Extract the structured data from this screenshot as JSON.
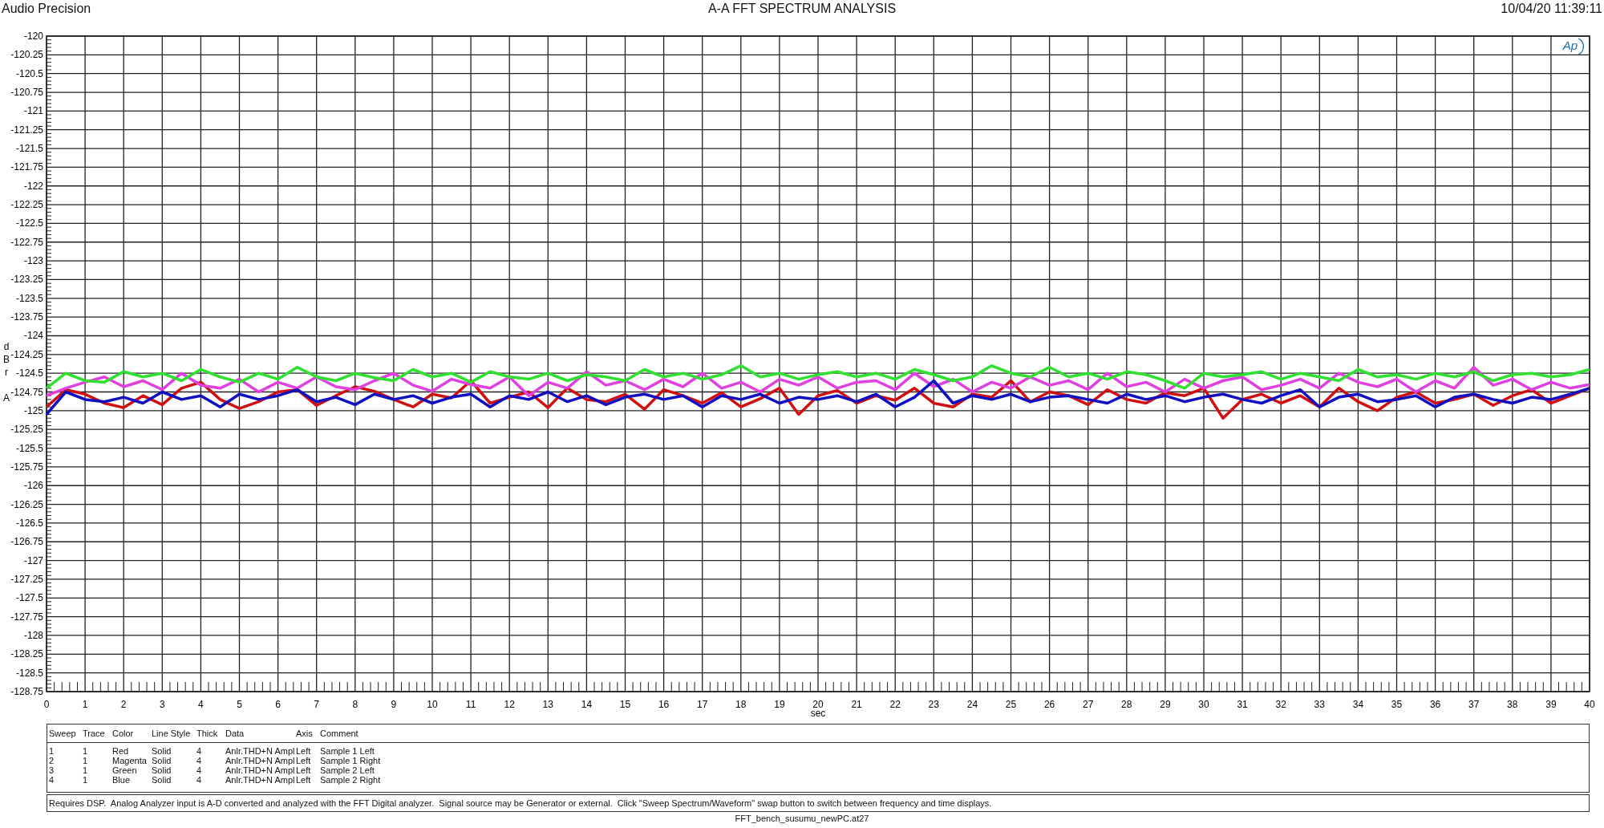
{
  "header": {
    "brand": "Audio Precision",
    "title": "A-A FFT SPECTRUM ANALYSIS",
    "timestamp": "10/04/20 11:39:11"
  },
  "plot": {
    "logo": "Ap",
    "chart_data": {
      "type": "line",
      "grid": true,
      "xlabel": "sec",
      "ylabel": "dBr A",
      "xlim": [
        0,
        40
      ],
      "ylim": [
        -128.75,
        -120
      ],
      "xticks": [
        0,
        1,
        2,
        3,
        4,
        5,
        6,
        7,
        8,
        9,
        10,
        11,
        12,
        13,
        14,
        15,
        16,
        17,
        18,
        19,
        20,
        21,
        22,
        23,
        24,
        25,
        26,
        27,
        28,
        29,
        30,
        31,
        32,
        33,
        34,
        35,
        36,
        37,
        38,
        39,
        40
      ],
      "yticks": [
        -120,
        -120.25,
        -120.5,
        -120.75,
        -121,
        -121.25,
        -121.5,
        -121.75,
        -122,
        -122.25,
        -122.5,
        -122.75,
        -123,
        -123.25,
        -123.5,
        -123.75,
        -124,
        -124.25,
        -124.5,
        -124.75,
        -125,
        -125.25,
        -125.5,
        -125.75,
        -126,
        -126.25,
        -126.5,
        -126.75,
        -127,
        -127.25,
        -127.5,
        -127.75,
        -128,
        -128.25,
        -128.5,
        -128.75
      ],
      "x": [
        0,
        0.5,
        1,
        1.5,
        2,
        2.5,
        3,
        3.5,
        4,
        4.5,
        5,
        5.5,
        6,
        6.5,
        7,
        7.5,
        8,
        8.5,
        9,
        9.5,
        10,
        10.5,
        11,
        11.5,
        12,
        12.5,
        13,
        13.5,
        14,
        14.5,
        15,
        15.5,
        16,
        16.5,
        17,
        17.5,
        18,
        18.5,
        19,
        19.5,
        20,
        20.5,
        21,
        21.5,
        22,
        22.5,
        23,
        23.5,
        24,
        24.5,
        25,
        25.5,
        26,
        26.5,
        27,
        27.5,
        28,
        28.5,
        29,
        29.5,
        30,
        30.5,
        31,
        31.5,
        32,
        32.5,
        33,
        33.5,
        34,
        34.5,
        35,
        35.5,
        36,
        36.5,
        37,
        37.5,
        38,
        38.5,
        39,
        39.5,
        40
      ],
      "series": [
        {
          "name": "Sample 1 Left",
          "color": "#d01010",
          "values": [
            -124.95,
            -124.72,
            -124.78,
            -124.9,
            -124.96,
            -124.8,
            -124.92,
            -124.7,
            -124.62,
            -124.85,
            -124.97,
            -124.88,
            -124.75,
            -124.72,
            -124.93,
            -124.8,
            -124.68,
            -124.74,
            -124.85,
            -124.95,
            -124.78,
            -124.83,
            -124.6,
            -124.9,
            -124.82,
            -124.75,
            -124.96,
            -124.7,
            -124.85,
            -124.88,
            -124.78,
            -124.98,
            -124.72,
            -124.8,
            -124.9,
            -124.76,
            -124.95,
            -124.84,
            -124.7,
            -125.05,
            -124.8,
            -124.73,
            -124.9,
            -124.8,
            -124.86,
            -124.7,
            -124.9,
            -124.95,
            -124.78,
            -124.82,
            -124.6,
            -124.88,
            -124.75,
            -124.8,
            -124.92,
            -124.72,
            -124.85,
            -124.9,
            -124.76,
            -124.8,
            -124.7,
            -125.1,
            -124.85,
            -124.78,
            -124.9,
            -124.8,
            -124.95,
            -124.7,
            -124.88,
            -125.0,
            -124.82,
            -124.75,
            -124.9,
            -124.85,
            -124.78,
            -124.93,
            -124.8,
            -124.72,
            -124.9,
            -124.8,
            -124.7
          ]
        },
        {
          "name": "Sample 1 Right",
          "color": "#e040e0",
          "values": [
            -124.8,
            -124.7,
            -124.62,
            -124.55,
            -124.68,
            -124.6,
            -124.72,
            -124.5,
            -124.66,
            -124.7,
            -124.58,
            -124.75,
            -124.62,
            -124.7,
            -124.55,
            -124.68,
            -124.72,
            -124.6,
            -124.5,
            -124.66,
            -124.74,
            -124.58,
            -124.65,
            -124.7,
            -124.55,
            -124.8,
            -124.62,
            -124.7,
            -124.48,
            -124.66,
            -124.6,
            -124.72,
            -124.58,
            -124.68,
            -124.5,
            -124.7,
            -124.62,
            -124.75,
            -124.58,
            -124.66,
            -124.55,
            -124.7,
            -124.62,
            -124.6,
            -124.72,
            -124.5,
            -124.68,
            -124.58,
            -124.75,
            -124.62,
            -124.7,
            -124.55,
            -124.66,
            -124.6,
            -124.72,
            -124.5,
            -124.68,
            -124.62,
            -124.75,
            -124.58,
            -124.7,
            -124.6,
            -124.55,
            -124.72,
            -124.66,
            -124.58,
            -124.7,
            -124.5,
            -124.62,
            -124.68,
            -124.58,
            -124.75,
            -124.6,
            -124.7,
            -124.42,
            -124.66,
            -124.58,
            -124.72,
            -124.62,
            -124.7,
            -124.65
          ]
        },
        {
          "name": "Sample 2 Left",
          "color": "#30e030",
          "values": [
            -124.7,
            -124.5,
            -124.6,
            -124.62,
            -124.48,
            -124.55,
            -124.5,
            -124.6,
            -124.45,
            -124.55,
            -124.62,
            -124.5,
            -124.58,
            -124.42,
            -124.55,
            -124.6,
            -124.5,
            -124.56,
            -124.6,
            -124.45,
            -124.55,
            -124.5,
            -124.62,
            -124.48,
            -124.55,
            -124.58,
            -124.5,
            -124.6,
            -124.52,
            -124.55,
            -124.6,
            -124.45,
            -124.55,
            -124.5,
            -124.58,
            -124.52,
            -124.4,
            -124.55,
            -124.5,
            -124.58,
            -124.52,
            -124.48,
            -124.55,
            -124.5,
            -124.58,
            -124.45,
            -124.52,
            -124.6,
            -124.55,
            -124.4,
            -124.5,
            -124.55,
            -124.42,
            -124.55,
            -124.5,
            -124.58,
            -124.48,
            -124.52,
            -124.6,
            -124.7,
            -124.5,
            -124.55,
            -124.52,
            -124.48,
            -124.58,
            -124.5,
            -124.55,
            -124.6,
            -124.45,
            -124.55,
            -124.52,
            -124.58,
            -124.5,
            -124.55,
            -124.48,
            -124.6,
            -124.52,
            -124.5,
            -124.55,
            -124.52,
            -124.45
          ]
        },
        {
          "name": "Sample 2 Right",
          "color": "#1010c0",
          "values": [
            -125.05,
            -124.75,
            -124.85,
            -124.88,
            -124.82,
            -124.9,
            -124.75,
            -124.85,
            -124.8,
            -124.95,
            -124.78,
            -124.85,
            -124.8,
            -124.72,
            -124.88,
            -124.82,
            -124.92,
            -124.78,
            -124.85,
            -124.8,
            -124.9,
            -124.82,
            -124.78,
            -124.95,
            -124.8,
            -124.85,
            -124.75,
            -124.88,
            -124.8,
            -124.92,
            -124.82,
            -124.78,
            -124.85,
            -124.8,
            -124.95,
            -124.8,
            -124.85,
            -124.78,
            -124.9,
            -124.82,
            -124.85,
            -124.8,
            -124.88,
            -124.78,
            -124.95,
            -124.82,
            -124.6,
            -124.9,
            -124.8,
            -124.85,
            -124.78,
            -124.88,
            -124.82,
            -124.8,
            -124.85,
            -124.9,
            -124.78,
            -124.85,
            -124.8,
            -124.88,
            -124.82,
            -124.78,
            -124.85,
            -124.9,
            -124.8,
            -124.72,
            -124.95,
            -124.82,
            -124.78,
            -124.88,
            -124.85,
            -124.8,
            -124.95,
            -124.82,
            -124.78,
            -124.85,
            -124.9,
            -124.82,
            -124.85,
            -124.78,
            -124.7
          ]
        }
      ]
    }
  },
  "legend": {
    "columns": [
      "Sweep",
      "Trace",
      "Color",
      "Line Style",
      "Thick",
      "Data",
      "Axis",
      "Comment"
    ],
    "rows": [
      [
        "1",
        "1",
        "Red",
        "Solid",
        "4",
        "Anlr.THD+N Ampl",
        "Left"
      ],
      [
        "2",
        "1",
        "Magenta",
        "Solid",
        "4",
        "Anlr.THD+N Ampl",
        "Left"
      ],
      [
        "3",
        "1",
        "Green",
        "Solid",
        "4",
        "Anlr.THD+N Ampl",
        "Left"
      ],
      [
        "4",
        "1",
        "Blue",
        "Solid",
        "4",
        "Anlr.THD+N Ampl",
        "Left"
      ]
    ]
  },
  "note": "Requires DSP.  Analog Analyzer input is A-D converted and analyzed with the FFT Digital analyzer.  Signal source may be Generator or external.  Click \"Sweep Spectrum/Waveform\" swap button to switch between frequency and time displays.",
  "filename": "FFT_bench_susumu_newPC.at27"
}
